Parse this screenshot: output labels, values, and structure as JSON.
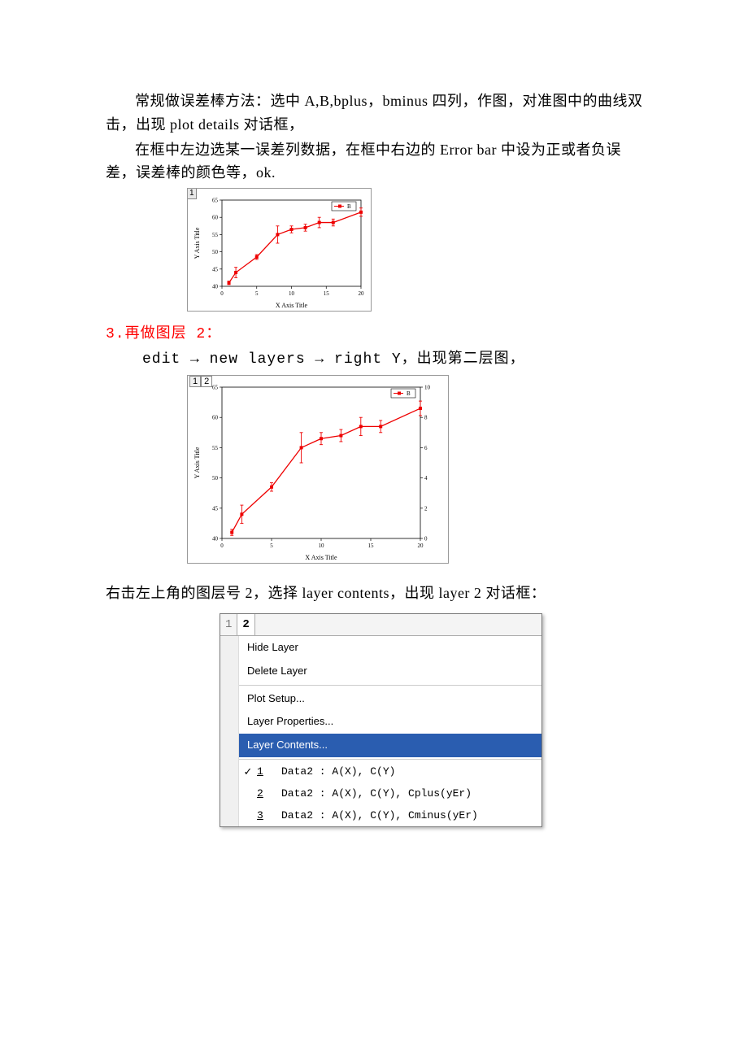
{
  "paragraphs": {
    "p1": "常规做误差棒方法：选中 A,B,bplus，bminus 四列，作图，对准图中的曲线双击，出现 plot details 对话框，",
    "p2": "在框中左边选某一误差列数据，在框中右边的 Error bar 中设为正或者负误差，误差棒的颜色等，ok.",
    "h3": "3.再做图层 2：",
    "p3": "edit → new layers → right Y，出现第二层图，",
    "p4": "右击左上角的图层号 2，选择 layer contents，出现 layer 2 对话框："
  },
  "chart_data": [
    {
      "type": "line",
      "layer_label": "1",
      "legend": "B",
      "xlabel": "X Axis Title",
      "ylabel": "Y Axis Title",
      "xlim": [
        0,
        20
      ],
      "ylim": [
        40,
        65
      ],
      "xticks": [
        0,
        5,
        10,
        15,
        20
      ],
      "yticks": [
        40,
        45,
        50,
        55,
        60,
        65
      ],
      "series": [
        {
          "name": "B",
          "x": [
            1,
            2,
            5,
            8,
            10,
            12,
            14,
            16,
            20
          ],
          "y": [
            41,
            44,
            48.5,
            55,
            56.5,
            57,
            58.5,
            58.5,
            61.5
          ],
          "err": [
            0.5,
            1.5,
            0.7,
            2.5,
            1,
            1,
            1.5,
            1,
            1.2
          ]
        }
      ]
    },
    {
      "type": "line",
      "layer_label": "1 2",
      "legend": "B",
      "xlabel": "X Axis Title",
      "ylabel": "Y Axis Title",
      "xlim": [
        0,
        20
      ],
      "ylim": [
        40,
        65
      ],
      "y2lim": [
        0,
        10
      ],
      "xticks": [
        0,
        5,
        10,
        15,
        20
      ],
      "yticks": [
        40,
        45,
        50,
        55,
        60,
        65
      ],
      "y2ticks": [
        0,
        2,
        4,
        6,
        8,
        10
      ],
      "series": [
        {
          "name": "B",
          "x": [
            1,
            2,
            5,
            8,
            10,
            12,
            14,
            16,
            20
          ],
          "y": [
            41,
            44,
            48.5,
            55,
            56.5,
            57,
            58.5,
            58.5,
            61.5
          ],
          "err": [
            0.5,
            1.5,
            0.7,
            2.5,
            1,
            1,
            1.5,
            1,
            1.2
          ]
        }
      ]
    }
  ],
  "menu": {
    "header": {
      "tab1": "1",
      "tab2": "2"
    },
    "items": [
      {
        "label": "Hide Layer"
      },
      {
        "label": "Delete Layer"
      },
      {
        "sep": true
      },
      {
        "label": "Plot Setup..."
      },
      {
        "label": "Layer Properties..."
      },
      {
        "label": "Layer Contents...",
        "highlight": true
      },
      {
        "sep": true
      }
    ],
    "data_items": [
      {
        "checked": true,
        "num": "1",
        "txt": "Data2 : A(X), C(Y)"
      },
      {
        "checked": false,
        "num": "2",
        "txt": "Data2 : A(X), C(Y), Cplus(yEr)"
      },
      {
        "checked": false,
        "num": "3",
        "txt": "Data2 : A(X), C(Y), Cminus(yEr)"
      }
    ]
  }
}
